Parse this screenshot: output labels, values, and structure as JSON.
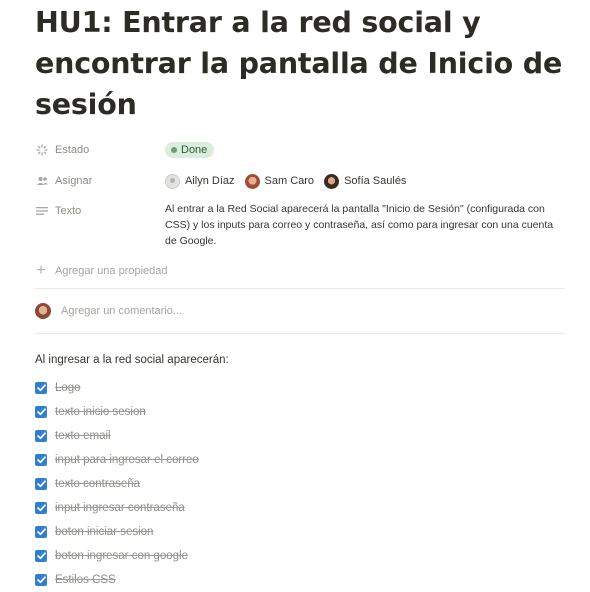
{
  "title": "HU1: Entrar a la red social y encontrar la pantalla de Inicio de sesión",
  "properties": {
    "estado": {
      "label": "Estado",
      "icon": "status-icon",
      "value": "Done",
      "color": "#dbeddb"
    },
    "asignar": {
      "label": "Asignar",
      "icon": "people-icon",
      "people": [
        {
          "name": "Ailyn Díaz",
          "avatar": "default-avatar"
        },
        {
          "name": "Sam Caro",
          "avatar": "photo-avatar"
        },
        {
          "name": "Sofía Saulés",
          "avatar": "photo-avatar"
        }
      ]
    },
    "texto": {
      "label": "Texto",
      "icon": "text-lines-icon",
      "value": "Al entrar a la Red Social aparecerá la pantalla \"Inicio de Sesión\" (configurada con CSS) y los inputs para correo y contraseña, así como para ingresar con una cuenta de Google."
    }
  },
  "add_property": {
    "label": "Agregar una propiedad",
    "icon": "plus-icon"
  },
  "comment": {
    "placeholder": "Agregar un comentario..."
  },
  "intro": "Al ingresar a la red social aparecerán:",
  "checklist": [
    {
      "label": "Logo",
      "checked": true
    },
    {
      "label": "texto inicio sesion",
      "checked": true
    },
    {
      "label": "texto email",
      "checked": true
    },
    {
      "label": "input para ingresar el correo",
      "checked": true
    },
    {
      "label": "texto contraseña",
      "checked": true
    },
    {
      "label": "input ingresar contraseña",
      "checked": true
    },
    {
      "label": "boton iniciar sesion",
      "checked": true
    },
    {
      "label": "boton ingresar con google",
      "checked": true
    },
    {
      "label": "Estilos CSS",
      "checked": true
    }
  ],
  "colors": {
    "checkbox": "#2f80d1",
    "done_badge": "#dbeddb",
    "done_dot": "#6c9b7d"
  }
}
